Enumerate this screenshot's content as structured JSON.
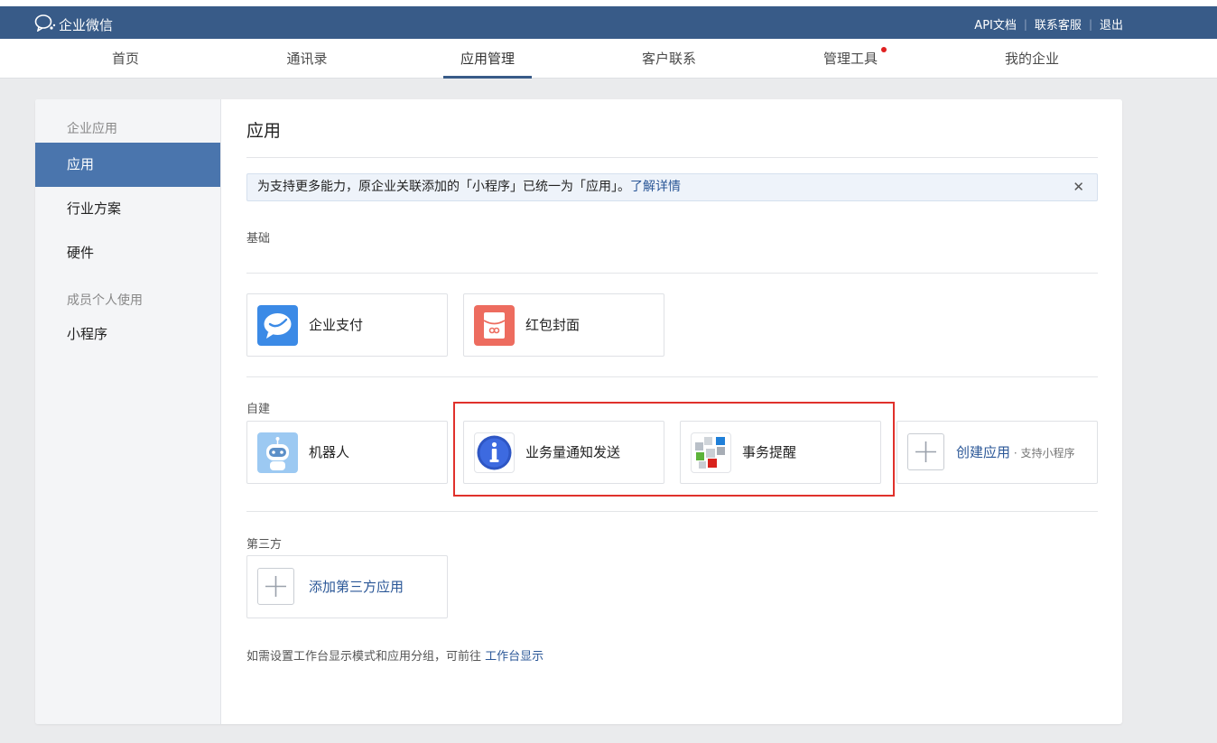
{
  "topbar": {
    "logo_text": "企业微信",
    "links": [
      "API文档",
      "联系客服",
      "退出"
    ]
  },
  "nav": {
    "items": [
      "首页",
      "通讯录",
      "应用管理",
      "客户联系",
      "管理工具",
      "我的企业"
    ],
    "active": "应用管理"
  },
  "sidebar": {
    "group1": "企业应用",
    "items1": [
      "应用",
      "行业方案",
      "硬件"
    ],
    "group2": "成员个人使用",
    "items2": [
      "小程序"
    ]
  },
  "main": {
    "title": "应用",
    "notice": {
      "text": "为支持更多能力，原企业关联添加的「小程序」已统一为「应用」。",
      "link": "了解详情",
      "close": "✕"
    },
    "sections": {
      "basic": "基础",
      "custom": "自建",
      "third": "第三方"
    },
    "basic_apps": [
      "企业支付",
      "红包封面"
    ],
    "custom_apps": [
      "机器人",
      "业务量通知发送",
      "事务提醒"
    ],
    "create_app": {
      "label": "创建应用",
      "sub": " · 支持小程序"
    },
    "add_third": "添加第三方应用",
    "footer": {
      "text": "如需设置工作台显示模式和应用分组，可前往",
      "link": "工作台显示"
    }
  },
  "colors": {
    "topbar": "#385b88",
    "accent": "#4a75ad",
    "link": "#2b5797",
    "highlight": "#e0312b"
  }
}
